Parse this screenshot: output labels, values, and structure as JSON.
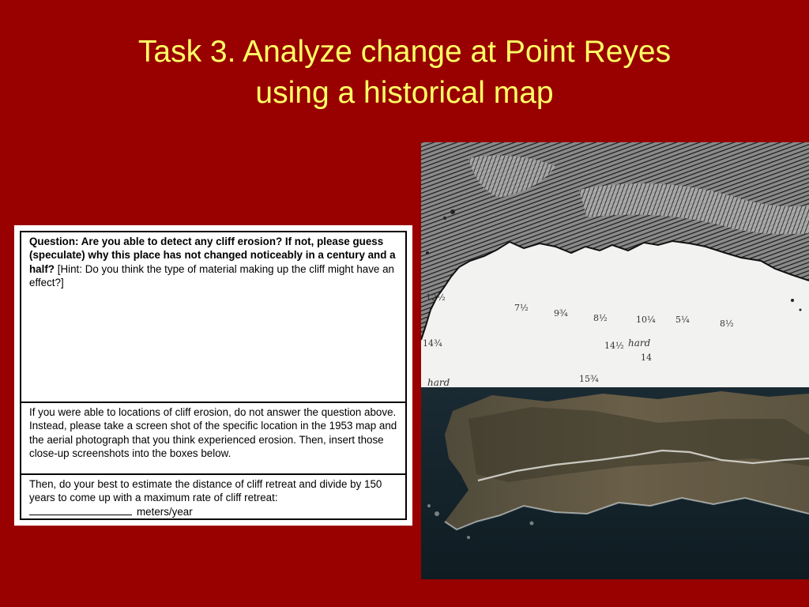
{
  "slide": {
    "title_line1": "Task 3.  Analyze change at Point Reyes",
    "title_line2": "using a historical map"
  },
  "worksheet": {
    "q1_bold": "Question:  Are you able to detect any cliff erosion?  If not, please guess (speculate) why this place has not changed noticeably in a century and a half?",
    "q1_hint": " [Hint: Do you think the type of material making up the cliff might have an effect?]",
    "q2_text": "If you were able to locations of cliff erosion, do not answer the question above.  Instead, please take a screen shot of the specific location in the 1953 map and the aerial photograph that you think experienced erosion. Then, insert those close-up screenshots into the boxes below.",
    "q3_text": "Then, do your best to estimate the distance of cliff retreat and divide by 150 years to come up with a maximum rate of cliff retreat:",
    "q3_units": "meters/year"
  },
  "historical_map": {
    "soundings": [
      "12½",
      "7½",
      "9¾",
      "8½",
      "10¼",
      "5¼",
      "8½",
      "14¾",
      "14½",
      "14",
      "15¾"
    ],
    "labels": [
      "hard",
      "hard"
    ]
  },
  "colors": {
    "background": "#990000",
    "title": "#ffff66"
  }
}
